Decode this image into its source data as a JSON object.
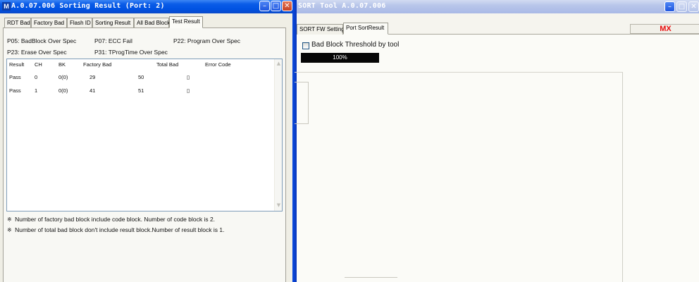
{
  "sort_tool_window": {
    "title": "SORT Tool A.0.07.006",
    "tabs": [
      {
        "label": "SORT FW Setting",
        "active": false
      },
      {
        "label": "Port SortResult",
        "active": true
      }
    ],
    "brand_label": "MX",
    "brand_color": "#e80e0e",
    "checkbox_label": "Bad Block Threshold by tool",
    "checkbox_checked": false,
    "progress_text": "100%",
    "progress_value": 1.0
  },
  "sorting_result_window": {
    "app_icon": "M",
    "title": "A.0.07.006 Sorting Result (Port: 2)",
    "tabs": [
      {
        "label": "RDT Bad",
        "active": false
      },
      {
        "label": "Factory Bad",
        "active": false
      },
      {
        "label": "Flash ID",
        "active": false
      },
      {
        "label": "Sorting Result",
        "active": false
      },
      {
        "label": "All Bad Block",
        "active": false
      },
      {
        "label": "Test Result",
        "active": true
      }
    ],
    "legend": {
      "p05": "P05: BadBlock Over Spec",
      "p07": "P07: ECC Fail",
      "p22": "P22: Program Over Spec",
      "p23": "P23: Erase Over Spec",
      "p31": "P31: TProgTime Over Spec"
    },
    "table": {
      "columns": [
        "Result",
        "CH",
        "BK",
        "Factory Bad",
        "Total Bad",
        "Error Code"
      ],
      "rows": [
        {
          "result": "Pass",
          "ch": "0",
          "bk": "0(0)",
          "factory_bad": "29",
          "total_bad": "50",
          "error_code": "▯"
        },
        {
          "result": "Pass",
          "ch": "1",
          "bk": "0(0)",
          "factory_bad": "41",
          "total_bad": "51",
          "error_code": "▯"
        }
      ]
    },
    "notes": {
      "mark": "※",
      "note1": "Number of factory bad block include code block. Number of code block is 2.",
      "note2": "Number of total bad block don't include result block.Number of result block is 1."
    }
  },
  "caption_buttons": {
    "minimize": "–",
    "maximize": "□",
    "close": "✕"
  }
}
